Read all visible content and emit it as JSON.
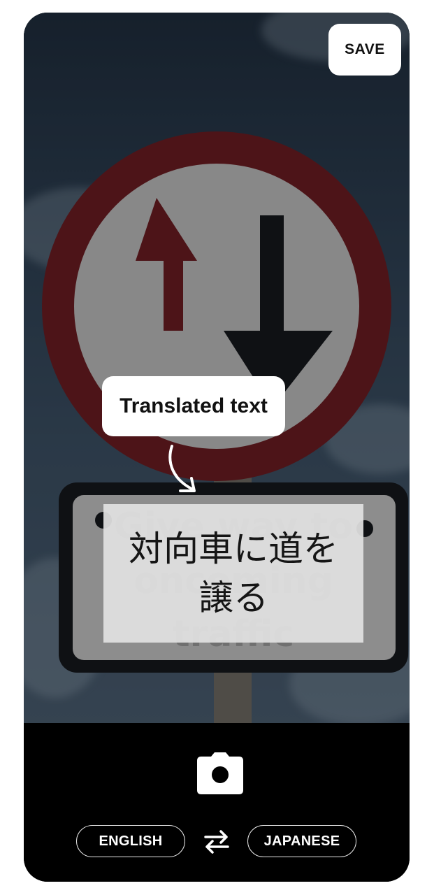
{
  "camera": {
    "save_label": "SAVE",
    "callout_label": "Translated text",
    "sign_text_original": "Give way to oncoming traffic",
    "translation_text": "対向車に道を譲る"
  },
  "controls": {
    "shutter_icon": "camera-icon",
    "source_language": "ENGLISH",
    "target_language": "JAPANESE",
    "swap_icon": "swap-arrows-icon"
  },
  "colors": {
    "sign_red": "#7a1f24",
    "sign_dark": "#15181d",
    "panel_bg": "#000000",
    "button_bg": "#ffffff"
  }
}
